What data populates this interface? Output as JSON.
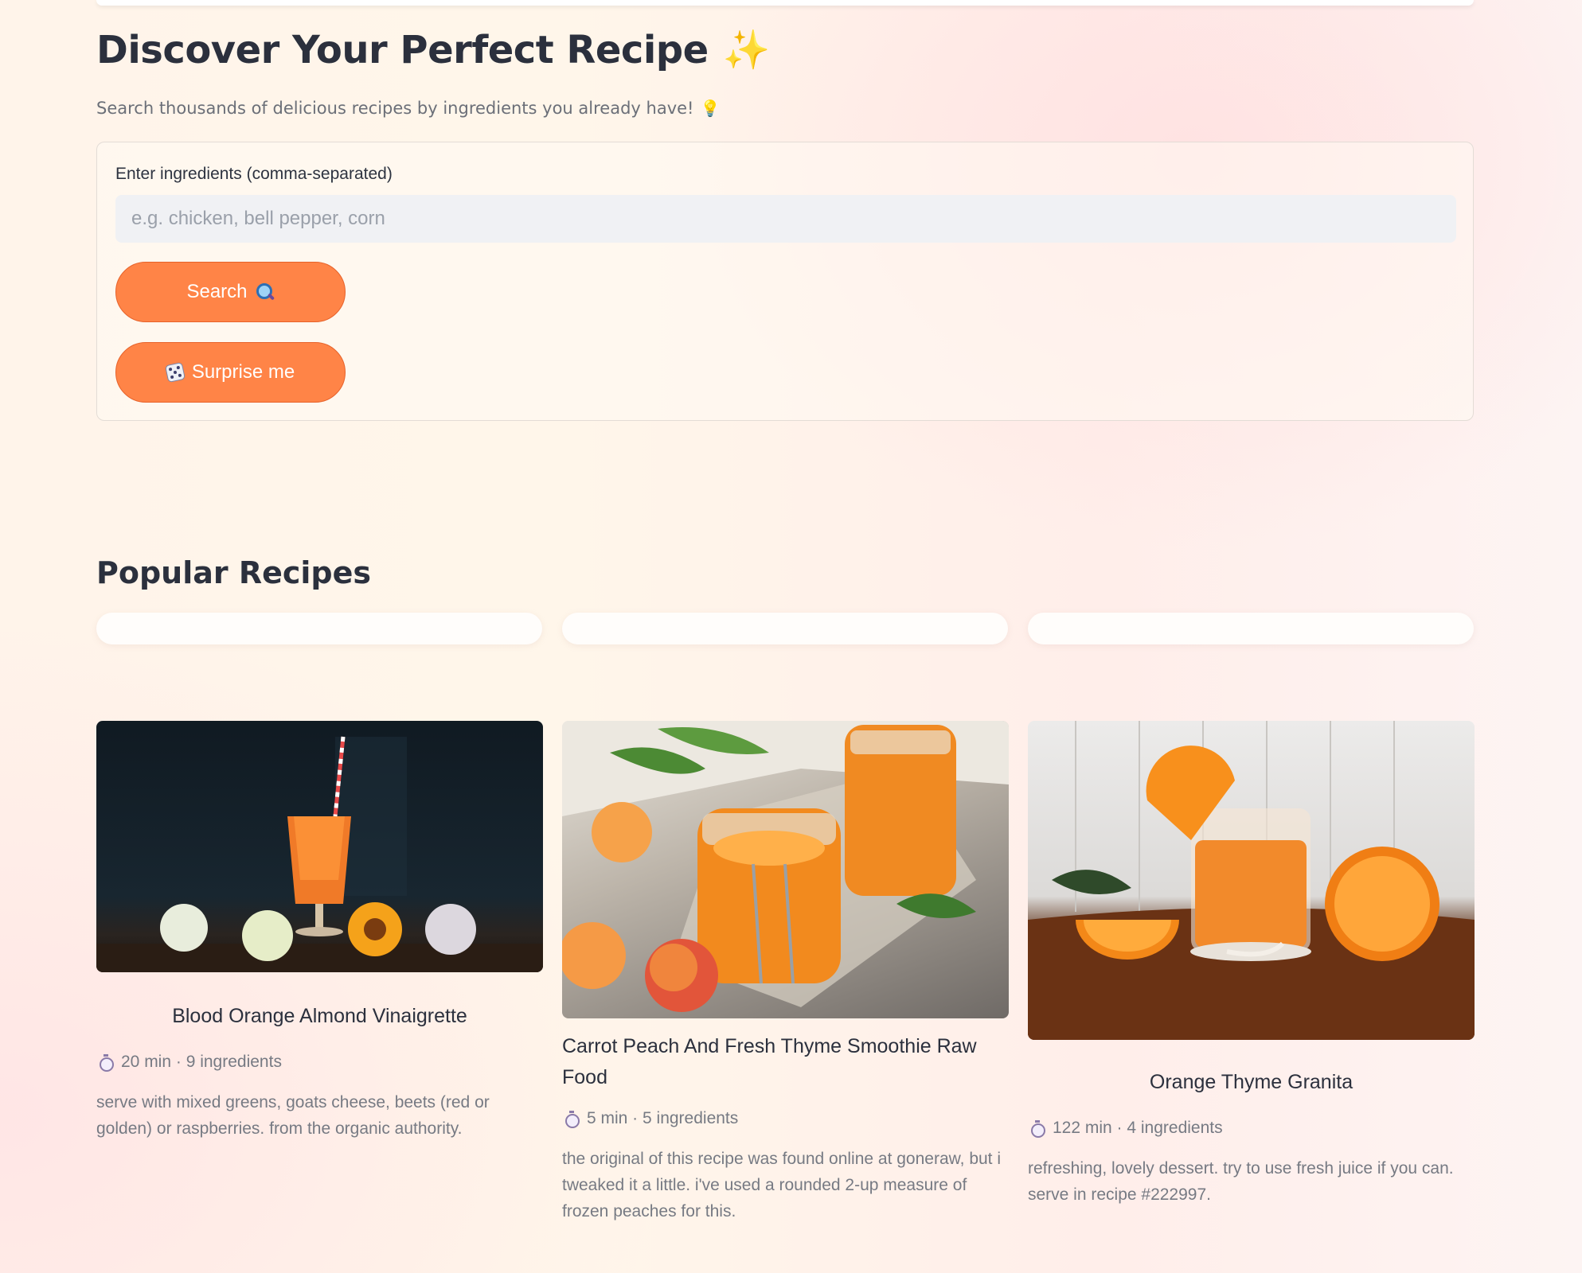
{
  "header": {
    "title": "Discover Your Perfect Recipe",
    "title_emoji": "✨",
    "subtitle": "Search thousands of delicious recipes by ingredients you already have!",
    "subtitle_emoji": "💡"
  },
  "search": {
    "label": "Enter ingredients (comma-separated)",
    "placeholder": "e.g. chicken, bell pepper, corn",
    "value": "",
    "search_button": "Search",
    "surprise_button": "Surprise me"
  },
  "popular": {
    "heading": "Popular Recipes",
    "recipes": [
      {
        "title": "Blood Orange Almond Vinaigrette",
        "meta": "20 min · 9 ingredients",
        "description": "serve with mixed greens, goats cheese, beets (red or golden) or raspberries. from the organic authority.",
        "image": "orange-cocktail-photo"
      },
      {
        "title": "Carrot Peach And Fresh Thyme Smoothie Raw Food",
        "meta": "5 min · 5 ingredients",
        "description": "the original of this recipe was found online at goneraw, but i tweaked it a little. i've used a rounded 2-up measure of frozen peaches for this.",
        "image": "peach-jam-jars-photo"
      },
      {
        "title": "Orange Thyme Granita",
        "meta": "122 min · 4 ingredients",
        "description": "refreshing, lovely dessert. try to use fresh juice if you can. serve in recipe #222997.",
        "image": "orange-juice-glass-photo"
      }
    ]
  },
  "colors": {
    "accent": "#ff8447",
    "accent_border": "#e7622a",
    "text_dark": "#2b303d",
    "text_muted": "#767a83"
  }
}
